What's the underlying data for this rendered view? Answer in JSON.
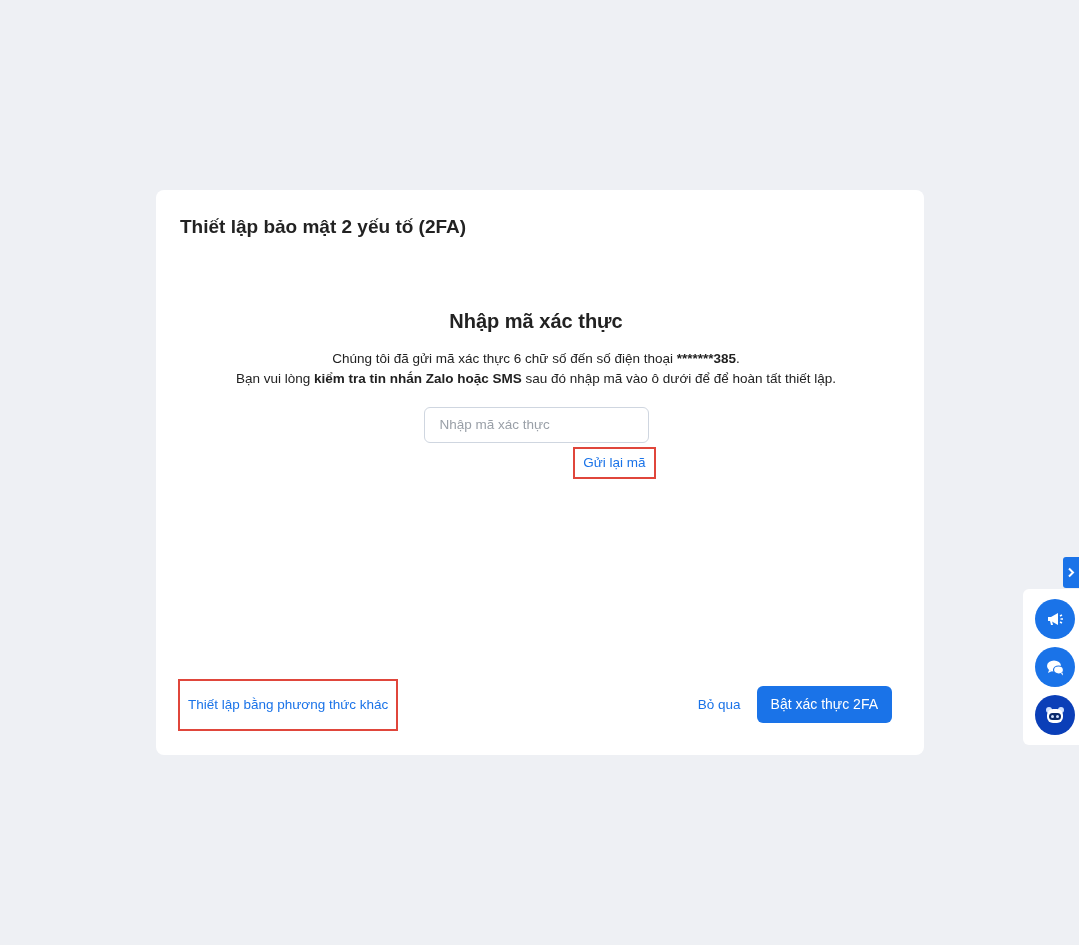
{
  "dialog": {
    "title": "Thiết lập bảo mật 2 yếu tố (2FA)",
    "heading": "Nhập mã xác thực",
    "sent_message": {
      "before": "Chúng tôi đã gửi mã xác thực 6 chữ số đến số điện thoại ",
      "phone": "*******385",
      "after": "."
    },
    "message_lines": [
      "Bạn vui lòng **kiểm tra tin nhắn Zalo hoặc SMS** sau đó nhập mã vào ô dưới để để hoàn tất thiết lập."
    ],
    "code_field": {
      "placeholder": "Nhập mã xác thực"
    },
    "resend_link": {
      "label": "Gửi lại mã",
      "highlighted": true
    },
    "other_method_link": {
      "label": "Thiết lập bằng phương thức khác",
      "highlighted": true
    },
    "skip_link": {
      "label": "Bỏ qua"
    },
    "enable_button": {
      "label": "Bật xác thực 2FA"
    }
  },
  "side_widget": {
    "buttons": [
      {
        "kind": "announcement"
      },
      {
        "kind": "chat"
      },
      {
        "kind": "bot"
      }
    ]
  }
}
